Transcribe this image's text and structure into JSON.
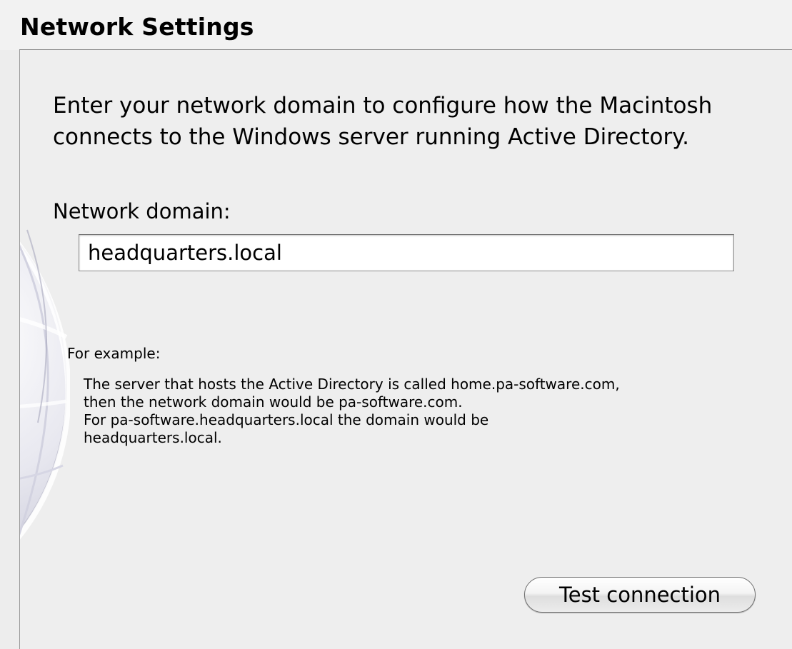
{
  "header": {
    "title": "Network Settings"
  },
  "intro": {
    "line1": "Enter your network domain to configure how the Macintosh",
    "line2": "connects to the Windows server running Active Directory."
  },
  "domain": {
    "label": "Network domain:",
    "value": "headquarters.local"
  },
  "example": {
    "label": "For example:",
    "lines": [
      "The server that hosts the Active Directory is called home.pa-software.com,",
      "then the network domain would be pa-software.com.",
      "For pa-software.headquarters.local the domain would be",
      "headquarters.local."
    ]
  },
  "actions": {
    "test_label": "Test connection"
  },
  "decor": {
    "background_art": "globe-icon"
  }
}
